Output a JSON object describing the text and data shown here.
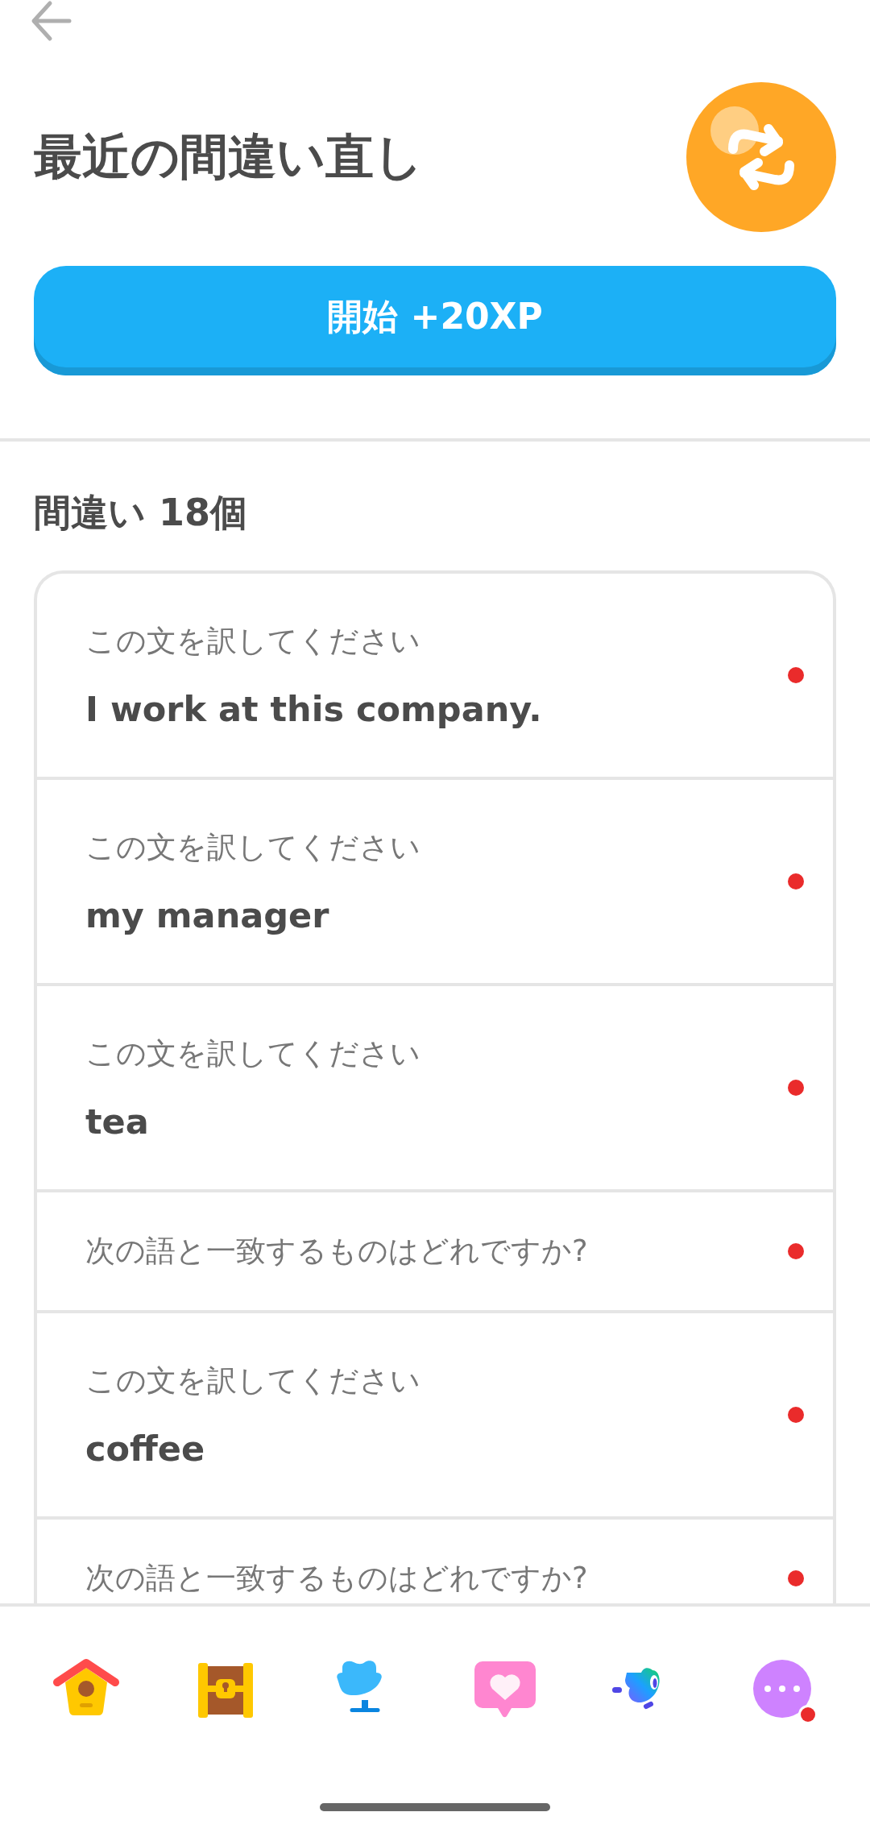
{
  "header": {
    "title": "最近の間違い直し"
  },
  "start_button": {
    "label": "開始 +20XP"
  },
  "mistakes": {
    "heading": "間違い 18個",
    "items": [
      {
        "prompt": "この文を訳してください",
        "sentence": "I work at this company."
      },
      {
        "prompt": "この文を訳してください",
        "sentence": "my manager"
      },
      {
        "prompt": "この文を訳してください",
        "sentence": "tea"
      },
      {
        "prompt": "次の語と一致するものはどれですか?"
      },
      {
        "prompt": "この文を訳してください",
        "sentence": "coffee"
      },
      {
        "prompt": "次の語と一致するものはどれですか?"
      }
    ]
  }
}
